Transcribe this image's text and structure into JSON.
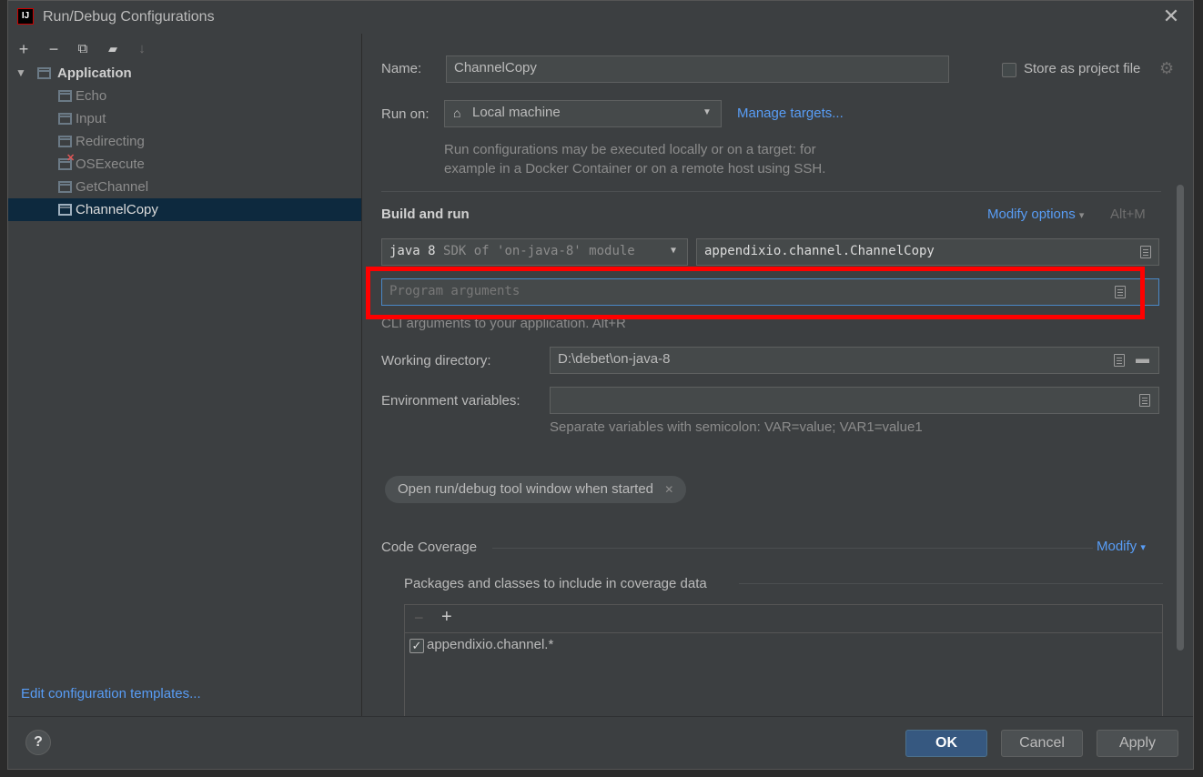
{
  "window": {
    "title": "Run/Debug Configurations",
    "close_glyph": "✕"
  },
  "toolbar": {
    "add": "+",
    "remove": "−",
    "copy": "⧉",
    "folder": "▰",
    "sort": "↓"
  },
  "tree": {
    "root": "Application",
    "items": [
      {
        "label": "Echo"
      },
      {
        "label": "Input"
      },
      {
        "label": "Redirecting"
      },
      {
        "label": "OSExecute"
      },
      {
        "label": "GetChannel"
      },
      {
        "label": "ChannelCopy"
      }
    ]
  },
  "left_footer": {
    "templates_link": "Edit configuration templates...",
    "help": "?"
  },
  "form": {
    "name_label": "Name:",
    "name_value": "ChannelCopy",
    "store_label": "Store as project file",
    "run_on_label": "Run on:",
    "run_on_value": "Local machine",
    "manage_targets": "Manage targets...",
    "run_on_hint_1": "Run configurations may be executed locally or on a target: for",
    "run_on_hint_2": "example in a Docker Container or on a remote host using SSH.",
    "build_run_header": "Build and run",
    "modify_options": "Modify options",
    "modify_shortcut": "Alt+M",
    "sdk_main": "java 8",
    "sdk_sub": "SDK of 'on-java-8' module",
    "main_class": "appendixio.channel.ChannelCopy",
    "program_args_placeholder": "Program arguments",
    "cli_hint": "CLI arguments to your application. Alt+R",
    "working_dir_label": "Working directory:",
    "working_dir_value": "D:\\debet\\on-java-8",
    "env_label": "Environment variables:",
    "env_value": "",
    "env_hint": "Separate variables with semicolon: VAR=value; VAR1=value1",
    "chip_label": "Open run/debug tool window when started",
    "coverage_header": "Code Coverage",
    "coverage_modify": "Modify",
    "packages_label": "Packages and classes to include in coverage data",
    "package_entry": "appendixio.channel.*"
  },
  "buttons": {
    "ok": "OK",
    "cancel": "Cancel",
    "apply": "Apply"
  },
  "colors": {
    "accent": "#589df6",
    "highlight": "#ff0000",
    "selected_row": "#0d293e"
  }
}
